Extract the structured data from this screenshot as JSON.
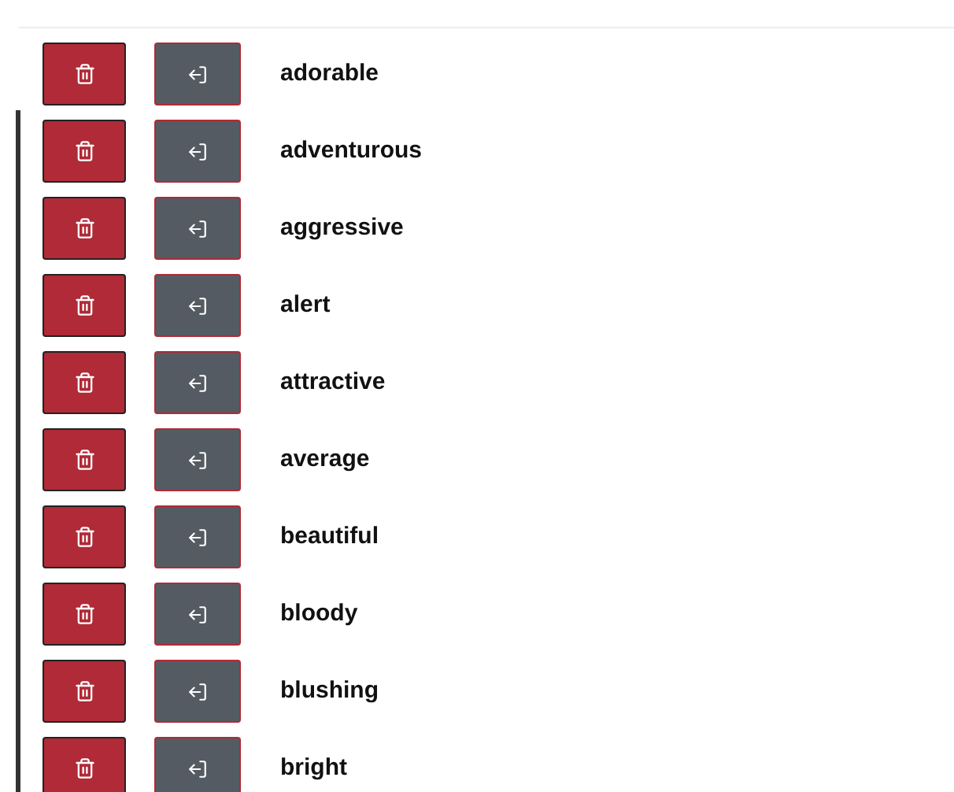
{
  "words": [
    {
      "label": "adorable"
    },
    {
      "label": "adventurous"
    },
    {
      "label": "aggressive"
    },
    {
      "label": "alert"
    },
    {
      "label": "attractive"
    },
    {
      "label": "average"
    },
    {
      "label": "beautiful"
    },
    {
      "label": "bloody"
    },
    {
      "label": "blushing"
    },
    {
      "label": "bright"
    }
  ]
}
